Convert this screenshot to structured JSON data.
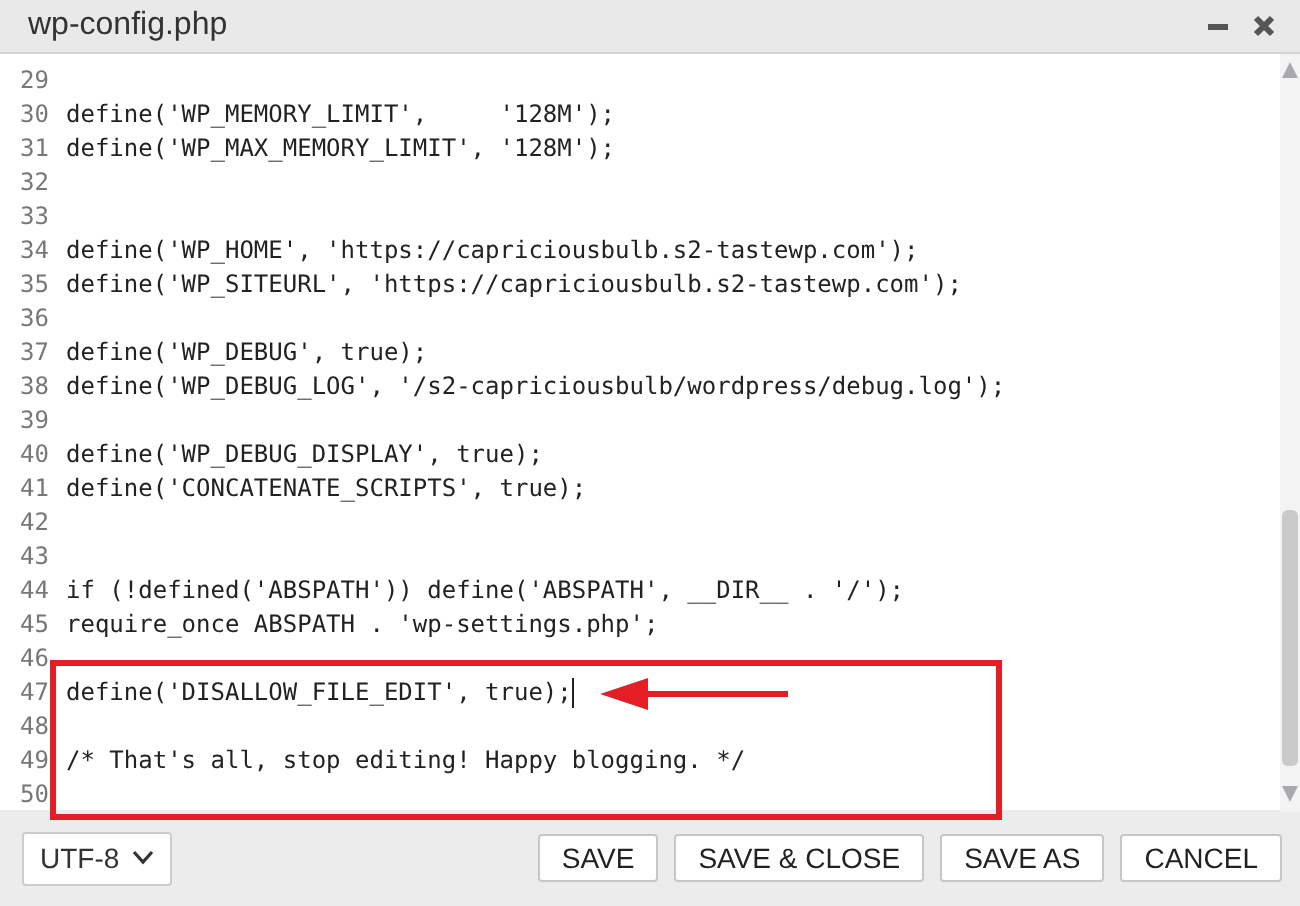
{
  "window": {
    "title": "wp-config.php"
  },
  "editor": {
    "lines": [
      {
        "number": "29"
      },
      {
        "number": "30",
        "code": "define('WP_MEMORY_LIMIT',     '128M');"
      },
      {
        "number": "31",
        "code": "define('WP_MAX_MEMORY_LIMIT', '128M');"
      },
      {
        "number": "32"
      },
      {
        "number": "33"
      },
      {
        "number": "34",
        "code": "define('WP_HOME', 'https://capriciousbulb.s2-tastewp.com');"
      },
      {
        "number": "35",
        "code": "define('WP_SITEURL', 'https://capriciousbulb.s2-tastewp.com');"
      },
      {
        "number": "36"
      },
      {
        "number": "37",
        "code": "define('WP_DEBUG', true);"
      },
      {
        "number": "38",
        "code": "define('WP_DEBUG_LOG', '/s2-capriciousbulb/wordpress/debug.log');"
      },
      {
        "number": "39"
      },
      {
        "number": "40",
        "code": "define('WP_DEBUG_DISPLAY', true);"
      },
      {
        "number": "41",
        "code": "define('CONCATENATE_SCRIPTS', true);"
      },
      {
        "number": "42"
      },
      {
        "number": "43"
      },
      {
        "number": "44",
        "code": "if (!defined('ABSPATH')) define('ABSPATH', __DIR__ . '/');"
      },
      {
        "number": "45",
        "code": "require_once ABSPATH . 'wp-settings.php';"
      },
      {
        "number": "46"
      }
    ],
    "highlighted_lines": [
      {
        "number": "47",
        "code": "define('DISALLOW_FILE_EDIT', true);",
        "cursor": true
      },
      {
        "number": "48",
        "cursor": false
      },
      {
        "number": "49",
        "code": "/* That's all, stop editing! Happy blogging. */",
        "cursor": false
      },
      {
        "number": "50",
        "cursor": false
      }
    ]
  },
  "footer": {
    "encoding": "UTF-8",
    "buttons": [
      "SAVE",
      "SAVE & CLOSE",
      "SAVE AS",
      "CANCEL"
    ]
  }
}
